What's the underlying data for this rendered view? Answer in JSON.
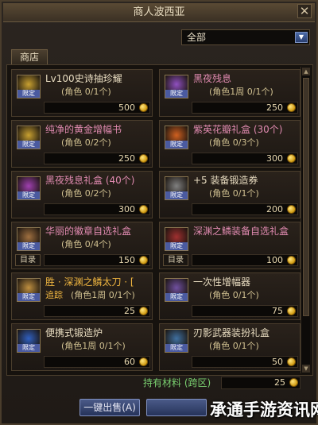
{
  "window": {
    "title": "商人波西亚",
    "close_symbol": "✕"
  },
  "filter": {
    "selected": "全部",
    "arrow": "▼"
  },
  "tab": {
    "label": "商店"
  },
  "icon_badge": "限定",
  "catalog_label": "目录",
  "items": [
    {
      "name": "Lv100史诗抽珍耀",
      "limit": "(角色 0/1个)",
      "price": "500",
      "name_color": "#e8dcc0",
      "has_catalog": false
    },
    {
      "name": "黑夜残息",
      "limit": "(角色1周 0/1个)",
      "price": "250",
      "name_color": "#e08ab0",
      "has_catalog": false
    },
    {
      "name": "纯净的黄金增幅书",
      "limit": "(角色 0/2个)",
      "price": "250",
      "name_color": "#e08ab0",
      "has_catalog": false
    },
    {
      "name": "紫英花瓣礼盒 (30个)",
      "limit": "(角色 0/3个)",
      "price": "300",
      "name_color": "#e08ab0",
      "has_catalog": false
    },
    {
      "name": "黑夜残息礼盒 (40个)",
      "limit": "(角色 0/2个)",
      "price": "300",
      "name_color": "#e08ab0",
      "has_catalog": false
    },
    {
      "name": "+5 装备锻造券",
      "limit": "(角色 0/1个)",
      "price": "200",
      "name_color": "#e8dcc0",
      "has_catalog": false
    },
    {
      "name": "华丽的徽章自选礼盒",
      "limit": "(角色 0/4个)",
      "price": "150",
      "name_color": "#e08ab0",
      "has_catalog": true
    },
    {
      "name": "深渊之鳞装备自选礼盒",
      "limit": "",
      "price": "100",
      "name_color": "#e08ab0",
      "has_catalog": true
    },
    {
      "name": "胜 · 深渊之鳞太刀 · [",
      "limit": "(角色1周 0/1个)",
      "price": "25",
      "name_color": "#f0b640",
      "has_catalog": false,
      "prefix": "追踪"
    },
    {
      "name": "一次性增幅器",
      "limit": "(角色 0/1个)",
      "price": "75",
      "name_color": "#e8dcc0",
      "has_catalog": false
    },
    {
      "name": "便携式锻造炉",
      "limit": "(角色1周 0/1个)",
      "price": "60",
      "name_color": "#e8dcc0",
      "has_catalog": false
    },
    {
      "name": "刃影武器装扮礼盒",
      "limit": "(角色 0/1个)",
      "price": "50",
      "name_color": "#e8dcc0",
      "has_catalog": false
    }
  ],
  "materials": {
    "label": "持有材料 (跨区)",
    "count": "25"
  },
  "buttons": {
    "sell_all": "一键出售(A)"
  },
  "watermark": "承通手游资讯网",
  "colors": {
    "accent_blue": "#4a5aa0",
    "pink_name": "#e08ab0",
    "gold_coin": "#f0b640"
  }
}
